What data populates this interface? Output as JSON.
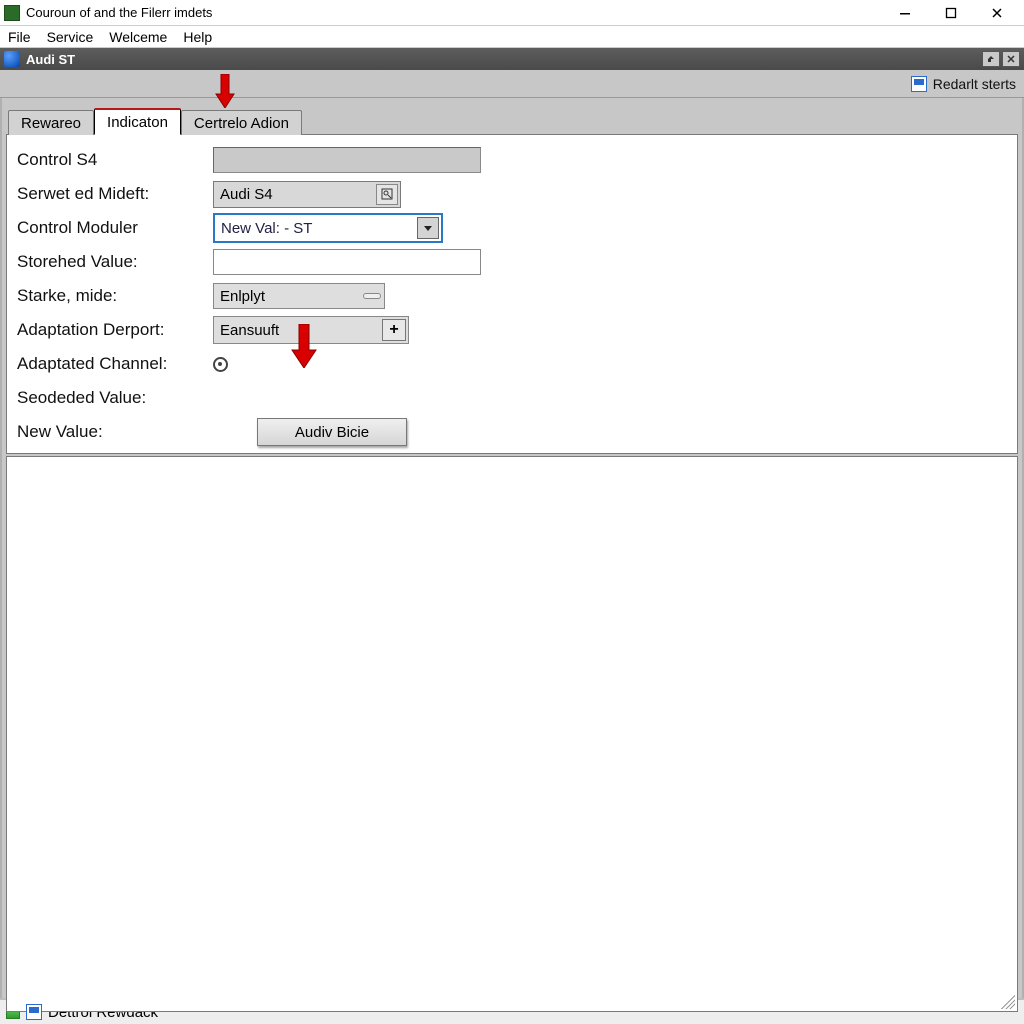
{
  "window": {
    "title": "Couroun of and the Filerr imdets"
  },
  "menubar": {
    "file": "File",
    "service": "Service",
    "welcome": "Welceme",
    "help": "Help"
  },
  "inner_window": {
    "title": "Audi ST"
  },
  "toolbar": {
    "default_link": "Redarlt sterts"
  },
  "tabs": {
    "t0": "Rewareo",
    "t1": "Indicaton",
    "t2": "Certrelo Adion"
  },
  "form": {
    "labels": {
      "control_s4": "Control S4",
      "serwet_mideft": "Serwet ed Mideft:",
      "control_moduler": "Control Moduler",
      "storehed_value": "Storehed Value:",
      "starke_mide": "Starke, mide:",
      "adaptation_derport": "Adaptation Derport:",
      "adaptated_channel": "Adaptated Channel:",
      "seodeded_value": "Seodeded Value:",
      "new_value": "New Value:"
    },
    "values": {
      "serwet_mideft": "Audi S4",
      "control_moduler": "New Val: - ST",
      "starke_mide": "Enlplyt",
      "adaptation_derport": "Eansuuft"
    },
    "action_button": "Audiv Bicie"
  },
  "statusbar": {
    "text": "Dettrol Rewdack"
  }
}
